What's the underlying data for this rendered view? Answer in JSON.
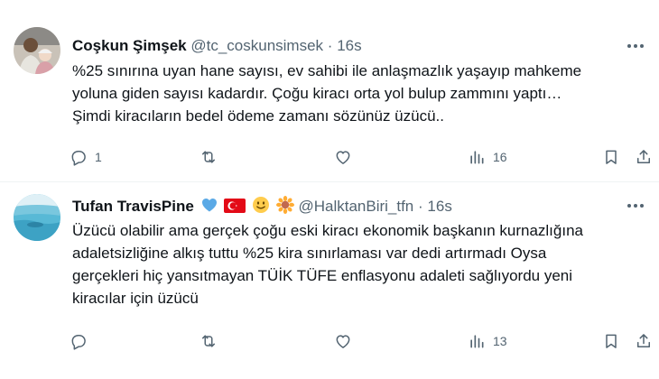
{
  "tweets": [
    {
      "author_name": "Coşkun Şimşek",
      "handle": "@tc_coskunsimsek",
      "separator": "·",
      "time": "16s",
      "emojis": [],
      "lines": [
        "%25 sınırına uyan hane sayısı, ev sahibi ile anlaşmazlık yaşayıp mahkeme",
        "yoluna giden sayısı kadardır. Çoğu kiracı orta yol bulup zammını yaptı…",
        "Şimdi kiracıların bedel ödeme zamanı sözünüz üzücü.."
      ],
      "reply_count": "1",
      "retweet_count": "",
      "like_count": "",
      "view_count": "16"
    },
    {
      "author_name": "Tufan TravisPine",
      "handle": "@HalktanBiri_tfn",
      "separator": "·",
      "time": "16s",
      "emojis": [
        "blue-heart",
        "turkish-flag",
        "smiling-face",
        "sunflower"
      ],
      "lines": [
        "Üzücü olabilir ama gerçek çoğu eski kiracı ekonomik başkanın kurnazlığına",
        "adaletsizliğine alkış tuttu %25 kira sınırlaması var dedi artırmadı Oysa",
        "gerçekleri hiç yansıtmayan TÜİK TÜFE enflasyonu adaleti sağlıyordu yeni",
        "kiracılar için üzücü"
      ],
      "reply_count": "",
      "retweet_count": "",
      "like_count": "",
      "view_count": "13"
    }
  ],
  "colors": {
    "primary_text": "#0f1419",
    "secondary_text": "#536471",
    "divider": "#eff3f4",
    "heart_emoji": "#5aa9e6",
    "flag_red": "#e30a17"
  }
}
